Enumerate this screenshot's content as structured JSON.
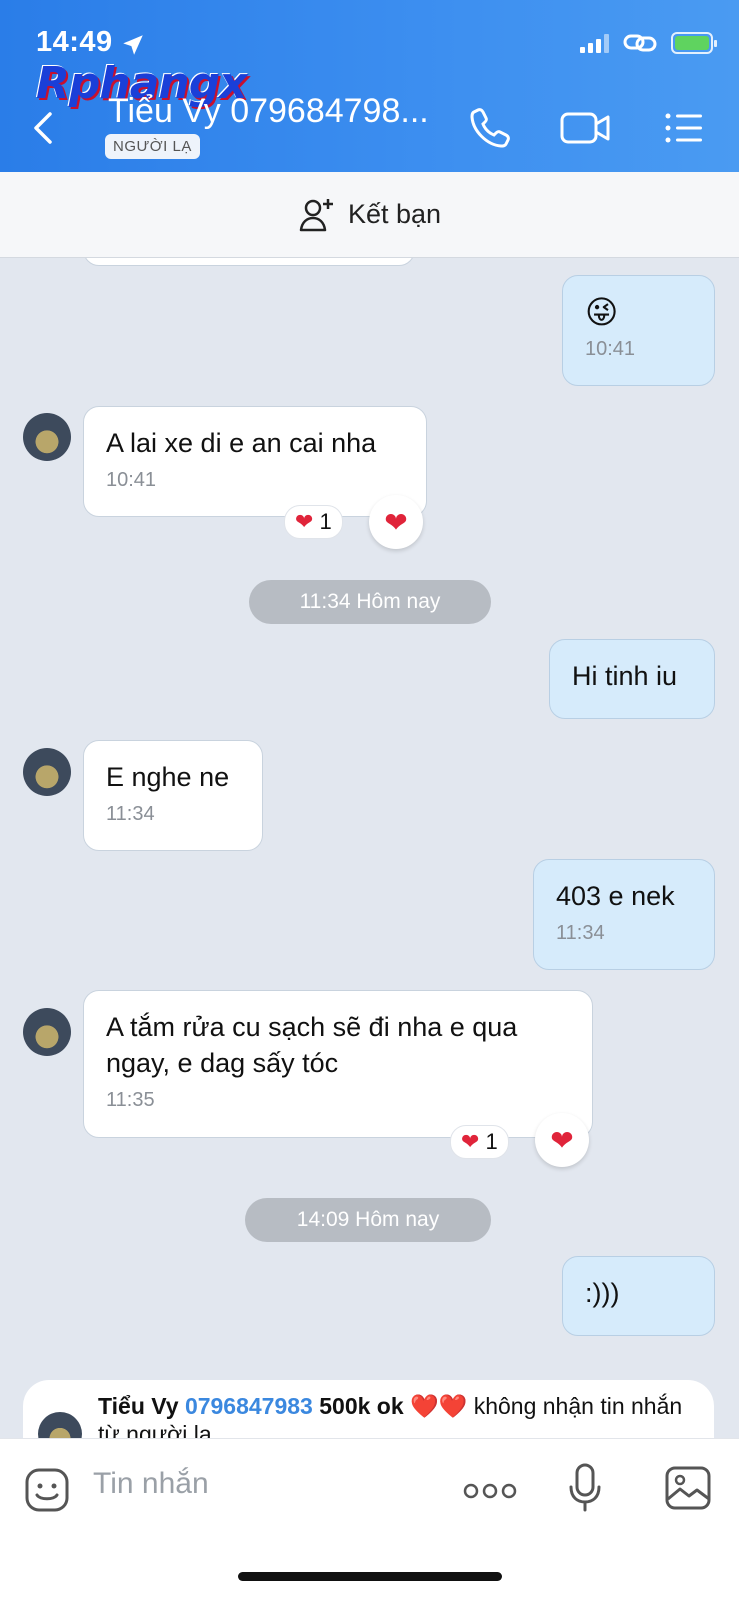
{
  "status": {
    "time": "14:49"
  },
  "watermark": "Rphangx",
  "header": {
    "title": "Tiểu Vy 0796847983 500k ok ❤️❤️",
    "title_display": "Tiểu Vy 079684798...",
    "badge": "NGƯỜI LẠ"
  },
  "friend_bar": {
    "label": "Kết bạn"
  },
  "messages": [
    {
      "dir": "out",
      "text": "😜",
      "time": "10:41"
    },
    {
      "dir": "in",
      "text": "A lai xe di e an cai nha",
      "time": "10:41",
      "reaction_count": "1",
      "reaction_icon": "heart-icon"
    },
    {
      "dir": "sep",
      "text": "11:34 Hôm nay"
    },
    {
      "dir": "out",
      "text": "Hi tinh iu",
      "time": ""
    },
    {
      "dir": "in",
      "text": "E nghe ne",
      "time": "11:34"
    },
    {
      "dir": "out",
      "text": "403 e nek",
      "time": "11:34"
    },
    {
      "dir": "in",
      "text": "A tắm rửa cu sạch sẽ đi nha e qua ngay, e dag sấy tóc",
      "time": "11:35",
      "reaction_count": "1",
      "reaction_icon": "heart-icon"
    },
    {
      "dir": "sep",
      "text": "14:09 Hôm nay"
    },
    {
      "dir": "out",
      "text": ":)))",
      "time": ""
    }
  ],
  "preview": {
    "name": "Tiểu Vy",
    "phone": "0796847983",
    "extra": "500k ok ❤️❤️",
    "text": "không nhận tin nhắn từ người lạ."
  },
  "input": {
    "placeholder": "Tin nhắn"
  },
  "colors": {
    "header": "#2a7de8",
    "outgoing": "#d6ebfb",
    "incoming": "#ffffff",
    "chat_bg": "#e2e7ef",
    "heart": "#e0243a"
  }
}
